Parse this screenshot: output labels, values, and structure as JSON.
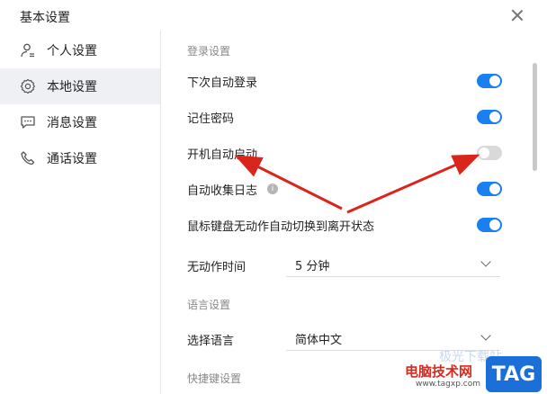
{
  "window": {
    "title": "基本设置"
  },
  "sidebar": {
    "items": [
      {
        "label": "个人设置",
        "icon": "user-icon"
      },
      {
        "label": "本地设置",
        "icon": "gear-icon"
      },
      {
        "label": "消息设置",
        "icon": "chat-icon"
      },
      {
        "label": "通话设置",
        "icon": "phone-icon"
      }
    ],
    "active": 1
  },
  "login": {
    "section_title": "登录设置",
    "auto_login": {
      "label": "下次自动登录",
      "on": true
    },
    "remember_password": {
      "label": "记住密码",
      "on": true
    },
    "auto_start": {
      "label": "开机自动启动",
      "on": false
    },
    "auto_log": {
      "label": "自动收集日志",
      "on": true
    },
    "idle_away": {
      "label": "鼠标键盘无动作自动切换到离开状态",
      "on": true
    },
    "idle_time": {
      "label": "无动作时间",
      "value": "5 分钟"
    }
  },
  "language": {
    "section_title": "语言设置",
    "select": {
      "label": "选择语言",
      "value": "简体中文"
    }
  },
  "shortcut": {
    "section_title": "快捷键设置"
  },
  "watermark": {
    "text": "电脑技术网",
    "url": "www.tagxp.com",
    "tag": "TAG",
    "faint": "极光下载站"
  },
  "colors": {
    "accent": "#1a7ff0",
    "arrow": "#d9251c"
  }
}
